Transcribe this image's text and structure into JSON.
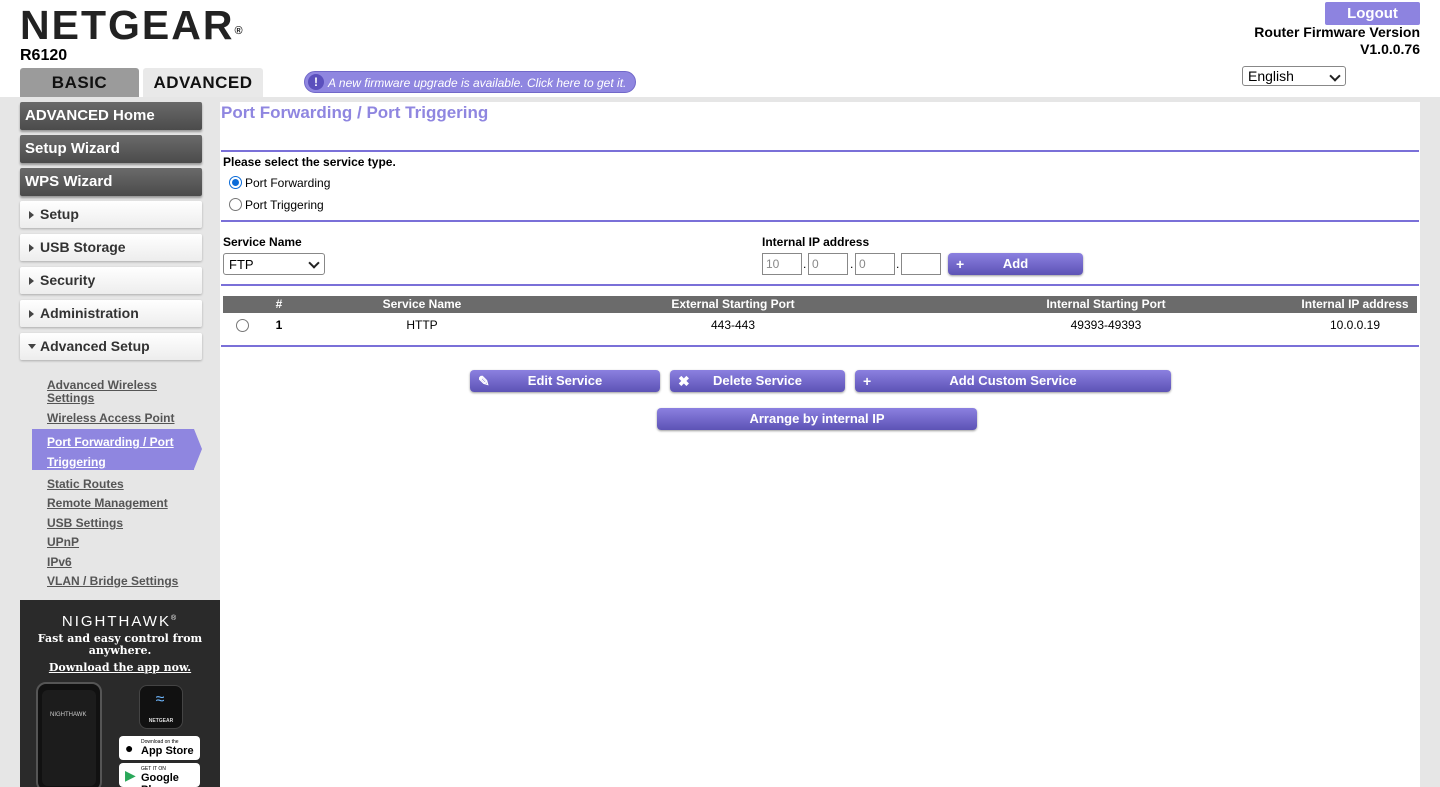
{
  "header": {
    "brand": "NETGEAR",
    "brand_mark": "®",
    "model": "R6120",
    "tabs": [
      {
        "label": "BASIC"
      },
      {
        "label": "ADVANCED"
      }
    ],
    "firmware_banner": "A new firmware upgrade is available. Click here to get it.",
    "logout_label": "Logout",
    "firmware_label": "Router Firmware Version",
    "firmware_version": "V1.0.0.76",
    "language": "English"
  },
  "sidebar": {
    "primary": [
      {
        "label": "ADVANCED Home"
      },
      {
        "label": "Setup Wizard"
      },
      {
        "label": "WPS Wizard"
      }
    ],
    "sections": [
      {
        "label": "Setup"
      },
      {
        "label": "USB Storage"
      },
      {
        "label": "Security"
      },
      {
        "label": "Administration"
      },
      {
        "label": "Advanced Setup"
      }
    ],
    "subitems": [
      {
        "label": "Advanced Wireless Settings"
      },
      {
        "label": "Wireless Access Point"
      },
      {
        "label": "Port Forwarding / Port Triggering"
      },
      {
        "label": "Static Routes"
      },
      {
        "label": "Remote Management"
      },
      {
        "label": "USB Settings"
      },
      {
        "label": "UPnP"
      },
      {
        "label": "IPv6"
      },
      {
        "label": "VLAN / Bridge Settings"
      }
    ],
    "ad": {
      "title": "NIGHTHAWK",
      "mark": "®",
      "tagline_1": "Fast and easy control from",
      "tagline_2": "anywhere.",
      "link": "Download the app now.",
      "app_label": "NETGEAR",
      "phone_text": "NIGHTHAWK",
      "appstore_small": "Download on the",
      "appstore_big": "App Store",
      "googleplay_small": "GET IT ON",
      "googleplay_big": "Google Play"
    }
  },
  "main": {
    "title": "Port Forwarding / Port Triggering",
    "service_type_prompt": "Please select the service type.",
    "service_types": [
      {
        "label": "Port Forwarding",
        "selected": true
      },
      {
        "label": "Port Triggering",
        "selected": false
      }
    ],
    "service_name_label": "Service Name",
    "service_name_value": "FTP",
    "internal_ip_label": "Internal IP address",
    "ip_octets": [
      "10",
      "0",
      "0",
      ""
    ],
    "add_label": "Add",
    "table": {
      "headers": [
        "#",
        "Service Name",
        "External Starting Port",
        "Internal Starting Port",
        "Internal IP address"
      ],
      "rows": [
        {
          "num": "1",
          "service": "HTTP",
          "external": "443-443",
          "internal": "49393-49393",
          "ip": "10.0.0.19"
        }
      ]
    },
    "edit_label": "Edit Service",
    "delete_label": "Delete Service",
    "add_custom_label": "Add Custom Service",
    "arrange_label": "Arrange by internal IP"
  },
  "colors": {
    "accent": "#8f86e0",
    "button": "#6d63c8",
    "rule": "#7a70d8",
    "table_header": "#6b6b6b"
  },
  "icons": {
    "firmware": "exclamation-icon",
    "add": "plus-icon",
    "edit": "pencil-icon",
    "delete": "x-icon",
    "add_custom": "plus-icon",
    "section_collapsed": "triangle-right-icon",
    "section_expanded": "triangle-down-icon"
  }
}
